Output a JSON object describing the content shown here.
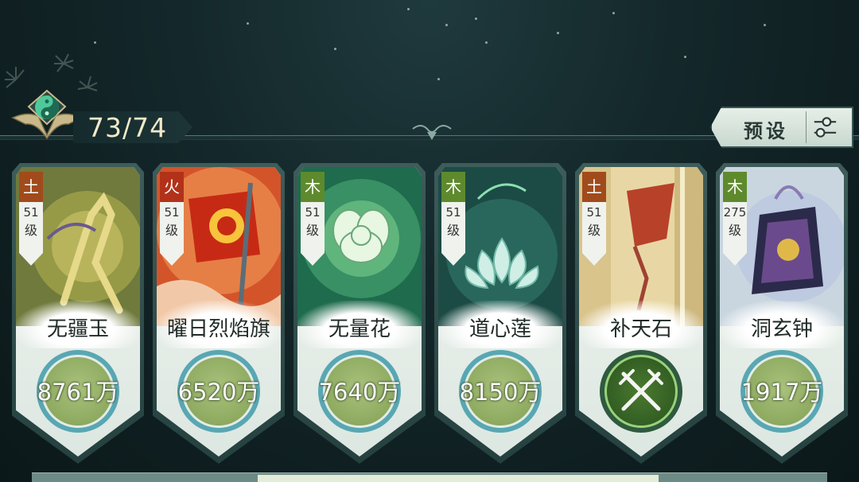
{
  "header": {
    "emblem_icon": "yin-yang-icon",
    "count": "73/74",
    "preset_label": "预设",
    "preset_icon": "sliders-icon"
  },
  "colors": {
    "earth": "#a14b1c",
    "fire": "#b23219",
    "wood": "#5e8a2d",
    "ring": "#58a7b3",
    "power_fill": "#8eaa60"
  },
  "cards": [
    {
      "element": "土",
      "level_num": "51",
      "level_unit": "级",
      "name": "无疆玉",
      "power": "8761万",
      "art_icon": "golden-figure-art"
    },
    {
      "element": "火",
      "level_num": "51",
      "level_unit": "级",
      "name": "曜日烈焰旗",
      "power": "6520万",
      "art_icon": "flame-banner-art"
    },
    {
      "element": "木",
      "level_num": "51",
      "level_unit": "级",
      "name": "无量花",
      "power": "7640万",
      "art_icon": "white-flower-art"
    },
    {
      "element": "木",
      "level_num": "51",
      "level_unit": "级",
      "name": "道心莲",
      "power": "8150万",
      "art_icon": "lotus-art"
    },
    {
      "element": "土",
      "level_num": "51",
      "level_unit": "级",
      "name": "补天石",
      "power": "",
      "art_icon": "stone-art",
      "center_icon": "crossed-swords-icon"
    },
    {
      "element": "木",
      "level_num": "275",
      "level_unit": "级",
      "name": "洞玄钟",
      "power": "1917万",
      "art_icon": "bell-art"
    }
  ]
}
